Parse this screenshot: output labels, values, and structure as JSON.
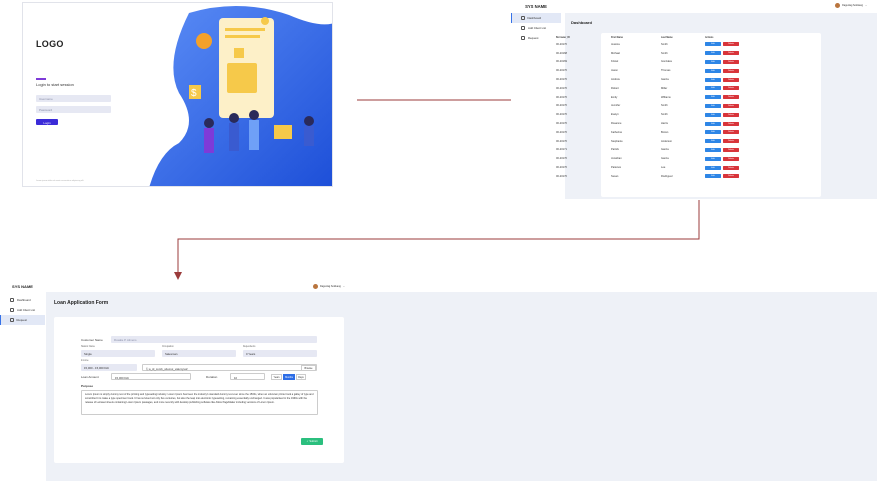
{
  "login": {
    "logo": "LOGO",
    "subtitle": "Login to start session",
    "username_placeholder": "Username",
    "password_placeholder": "Password",
    "login_button": "Login",
    "footer": "Lorem ipsum dolor sit amet consectetur adipiscing elit"
  },
  "app": {
    "sys_name": "SYS NAME",
    "user": "Dagunlag Solokang",
    "sidebar": [
      {
        "label": "Dashboard"
      },
      {
        "label": "Add Client List"
      },
      {
        "label": "Request"
      }
    ]
  },
  "dashboard": {
    "title": "Dashboard",
    "columns": [
      "Borrower_ID",
      "First Name",
      "Last Name",
      "Actions"
    ],
    "edit_label": "Edit",
    "delete_label": "Delete",
    "rows": [
      [
        "00-20170",
        "Jessica",
        "Smith"
      ],
      [
        "00-20168",
        "Michael",
        "Smith"
      ],
      [
        "00-20169",
        "Kristel",
        "Gonzales"
      ],
      [
        "00-20170",
        "Jason",
        "Thomas"
      ],
      [
        "00-20170",
        "Andrew",
        "Garcia"
      ],
      [
        "00-20170",
        "Robert",
        "Miller"
      ],
      [
        "00-20170",
        "Emily",
        "Williams"
      ],
      [
        "00-20170",
        "Jennifer",
        "Smith"
      ],
      [
        "00-20170",
        "Evelyn",
        "Smith"
      ],
      [
        "00-20170",
        "Rosanne",
        "Harris"
      ],
      [
        "00-20170",
        "Katherine",
        "Brown"
      ],
      [
        "00-20170",
        "Stephanie",
        "Anderson"
      ],
      [
        "00-20171",
        "Patrick",
        "Garcia"
      ],
      [
        "00-20170",
        "Jonathan",
        "Garcia"
      ],
      [
        "00-20170",
        "Patience",
        "Lee"
      ],
      [
        "00-20170",
        "Susan",
        "Rodriguez"
      ]
    ]
  },
  "form": {
    "title": "Loan Application Form",
    "customer_name_label": "Customer Name",
    "customer_name_value": "Rosalie P. Almeno",
    "loan_name_label": "Station Name",
    "loan_name_value": "Single",
    "occupation_label": "Occupation",
    "occupation_value": "Salesman",
    "dependents_label": "Dependents",
    "dependents_value": "0 Years",
    "income_label": "Income",
    "income_value": "15,000 - 15,000 Ddt",
    "file_value": "a_id_comb_vdemoi_valemyvaf",
    "browse_label": "Browse",
    "loan_amount_label": "Loan Amount",
    "loan_amount_value": "15,000 Ddt",
    "duration_label": "Duration",
    "duration_value": "10",
    "duration_units": [
      "Years",
      "Months",
      "Days"
    ],
    "duration_selected": "Months",
    "purpose_label": "Purpose",
    "purpose_text": "Lorem Ipsum is simply dummy text of the printing and typesetting industry. Lorem Ipsum has been the industry's standard dummy text ever since the 1500s, when an unknown printer took a galley of type and scrambled it to make a type specimen book. It has survived not only five centuries, but also the leap into electronic typesetting, remaining essentially unchanged. It was popularised in the 1960s with the release of Letraset sheets containing Lorem Ipsum passages, and more recently with desktop publishing software like Aldus PageMaker including versions of Lorem Ipsum.",
    "submit_label": "Submit"
  },
  "colors": {
    "primary": "#2e6ee6",
    "delete": "#d8353b",
    "submit": "#2bbf7e",
    "arrow": "#9b3b3b"
  }
}
